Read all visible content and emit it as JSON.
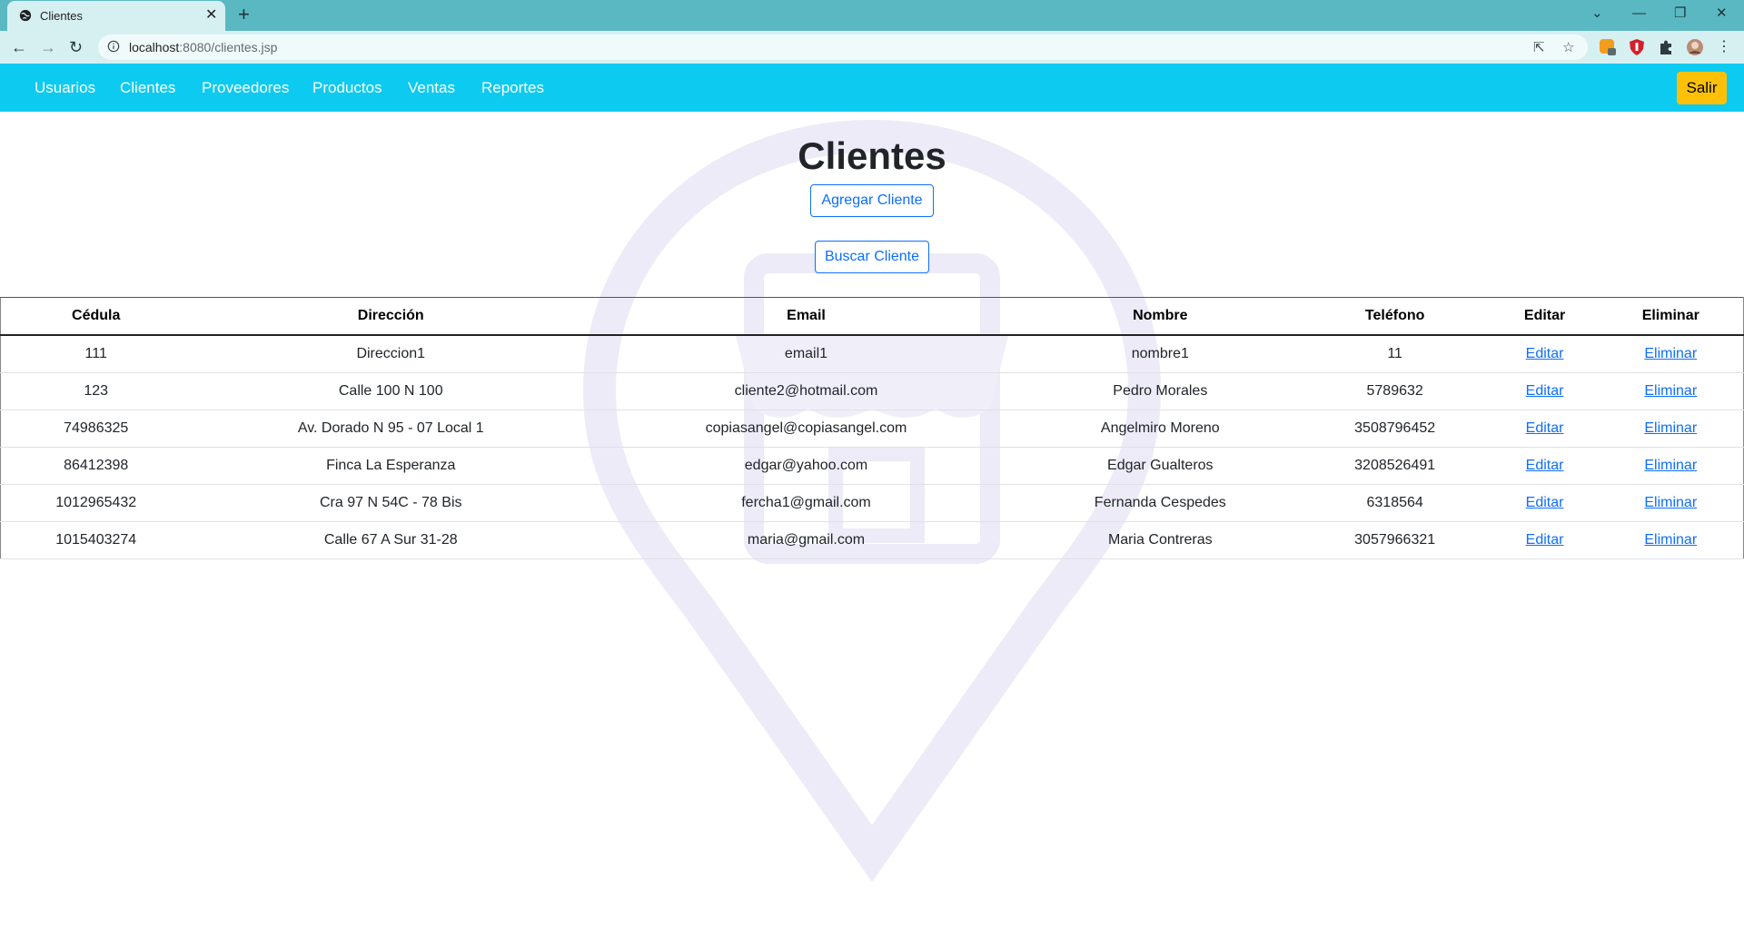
{
  "browser": {
    "tab_title": "Clientes",
    "tab_close": "✕",
    "new_tab": "+",
    "url_host": "localhost",
    "url_rest": ":8080/clientes.jsp",
    "window_controls": [
      "⌄",
      "—",
      "❐",
      "✕"
    ]
  },
  "navbar": {
    "links": [
      "Usuarios",
      "Clientes",
      "Proveedores",
      "Productos",
      "Ventas",
      "Reportes"
    ],
    "logout": "Salir",
    "bg_color": "#0dcaf0",
    "logout_color": "#ffc107"
  },
  "page": {
    "title": "Clientes",
    "add_button": "Agregar Cliente",
    "search_button": "Buscar Cliente",
    "accent_color": "#0d6efd"
  },
  "table": {
    "headers": [
      "Cédula",
      "Dirección",
      "Email",
      "Nombre",
      "Teléfono",
      "Editar",
      "Eliminar"
    ],
    "rows": [
      [
        "111",
        "Direccion1",
        "email1",
        "nombre1",
        "11",
        "Editar",
        "Eliminar"
      ],
      [
        "123",
        "Calle 100 N 100",
        "cliente2@hotmail.com",
        "Pedro Morales",
        "5789632",
        "Editar",
        "Eliminar"
      ],
      [
        "74986325",
        "Av. Dorado N 95 - 07 Local 1",
        "copiasangel@copiasangel.com",
        "Angelmiro Moreno",
        "3508796452",
        "Editar",
        "Eliminar"
      ],
      [
        "86412398",
        "Finca La Esperanza",
        "edgar@yahoo.com",
        "Edgar Gualteros",
        "3208526491",
        "Editar",
        "Eliminar"
      ],
      [
        "1012965432",
        "Cra 97 N 54C - 78 Bis",
        "fercha1@gmail.com",
        "Fernanda Cespedes",
        "6318564",
        "Editar",
        "Eliminar"
      ],
      [
        "1015403274",
        "Calle 67 A Sur 31-28",
        "maria@gmail.com",
        "Maria Contreras",
        "3057966321",
        "Editar",
        "Eliminar"
      ]
    ]
  }
}
